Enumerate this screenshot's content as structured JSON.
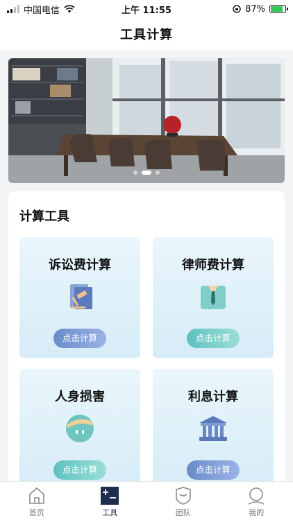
{
  "status_bar": {
    "carrier": "中国电信",
    "time": "上午 11:55",
    "battery": "87%",
    "battery_level": 0.87
  },
  "header": {
    "title": "工具计算"
  },
  "banner": {
    "slide_count": 3,
    "active_slide": 1
  },
  "section": {
    "title": "计算工具"
  },
  "tools": [
    {
      "name": "诉讼费计算",
      "button": "点击计算",
      "icon": "gavel-document-icon"
    },
    {
      "name": "律师费计算",
      "button": "点击计算",
      "icon": "lawyer-suit-icon"
    },
    {
      "name": "人身损害",
      "button": "点击计算",
      "icon": "bandaged-face-icon"
    },
    {
      "name": "利息计算",
      "button": "点击计算",
      "icon": "bank-building-icon"
    }
  ],
  "tab_bar": {
    "items": [
      {
        "label": "首页",
        "icon": "home-icon"
      },
      {
        "label": "工具",
        "icon": "calculator-icon"
      },
      {
        "label": "团队",
        "icon": "shield-icon"
      },
      {
        "label": "我的",
        "icon": "user-icon"
      }
    ],
    "active": "工具"
  },
  "colors": {
    "accent": "#1f2d4e",
    "button_blue": "#7f9fd8",
    "button_teal": "#7ccfc8"
  }
}
